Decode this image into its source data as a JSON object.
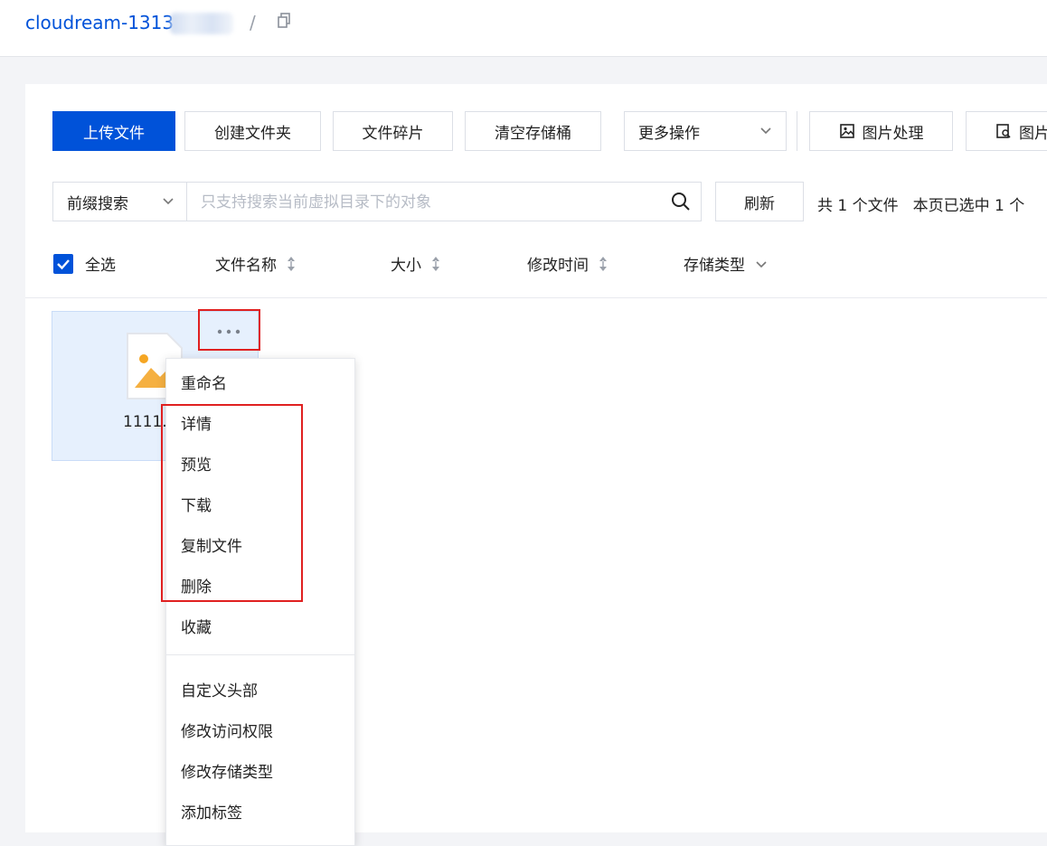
{
  "breadcrumb": {
    "bucket": "cloudream-1313",
    "separator": "/"
  },
  "toolbar": {
    "upload": "上传文件",
    "create_folder": "创建文件夹",
    "fragments": "文件碎片",
    "clear_bucket": "清空存储桶",
    "more_actions": "更多操作",
    "image_process": "图片处理",
    "image_more": "图片"
  },
  "search": {
    "prefix_label": "前缀搜索",
    "placeholder": "只支持搜索当前虚拟目录下的对象",
    "refresh": "刷新"
  },
  "summary": {
    "total": "共 1 个文件",
    "selected": "本页已选中 1 个"
  },
  "columns": {
    "select_all": "全选",
    "name": "文件名称",
    "size": "大小",
    "modified": "修改时间",
    "storage_class": "存储类型"
  },
  "file": {
    "name": "1111."
  },
  "context_menu": {
    "rename": "重命名",
    "details": "详情",
    "preview": "预览",
    "download": "下载",
    "copy_file": "复制文件",
    "delete": "删除",
    "favorite": "收藏",
    "custom_headers": "自定义头部",
    "access_permission": "修改访问权限",
    "storage_class": "修改存储类型",
    "add_tag": "添加标签"
  },
  "colors": {
    "primary": "#0052d9",
    "highlight": "#e02020",
    "selected_bg": "#e6f0fd"
  }
}
